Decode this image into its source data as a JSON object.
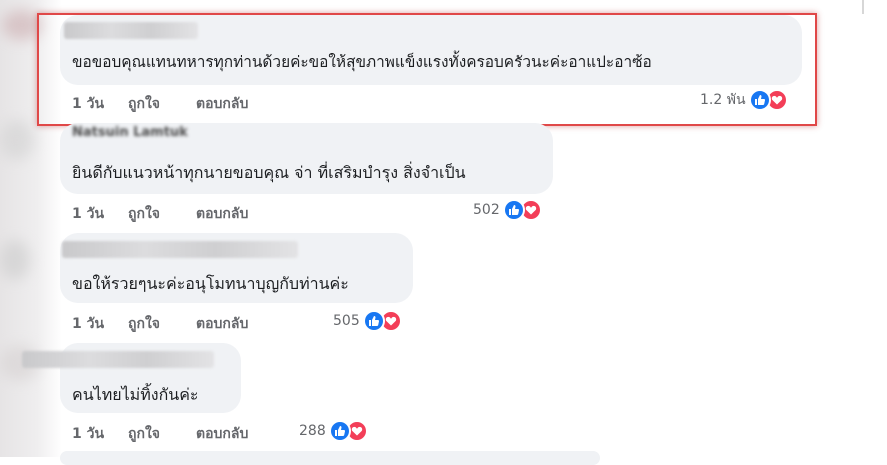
{
  "comments": [
    {
      "text": "ขอขอบคุณแทนทหารทุกท่านด้วยค่ะขอให้สุขภาพแข็งแรงทั้งครอบครัวนะค่ะอาแปะอาซ้อ",
      "time": "1 วัน",
      "like_label": "ถูกใจ",
      "reply_label": "ตอบกลับ",
      "reaction_count": "1.2 พัน"
    },
    {
      "author_blurred": "Natsuin Lamtuk",
      "text": "ยินดีกับแนวหน้าทุกนายขอบคุณ จ่า ที่เสริมบำรุง สิ่งจำเป็น",
      "time": "1 วัน",
      "like_label": "ถูกใจ",
      "reply_label": "ตอบกลับ",
      "reaction_count": "502"
    },
    {
      "text": "ขอให้รวยๆนะค่ะอนุโมทนาบุญกับท่านค่ะ",
      "time": "1 วัน",
      "like_label": "ถูกใจ",
      "reply_label": "ตอบกลับ",
      "reaction_count": "505"
    },
    {
      "text": "คนไทยไม่ทิ้งกันค่ะ",
      "time": "1 วัน",
      "like_label": "ถูกใจ",
      "reply_label": "ตอบกลับ",
      "reaction_count": "288"
    }
  ],
  "reaction_icons": [
    "like-icon",
    "love-icon"
  ],
  "colors": {
    "bubble": "#f0f2f5",
    "highlight_border": "#e04848",
    "like": "#1877f2",
    "love": "#f33e58",
    "secondary_text": "#65676b"
  }
}
